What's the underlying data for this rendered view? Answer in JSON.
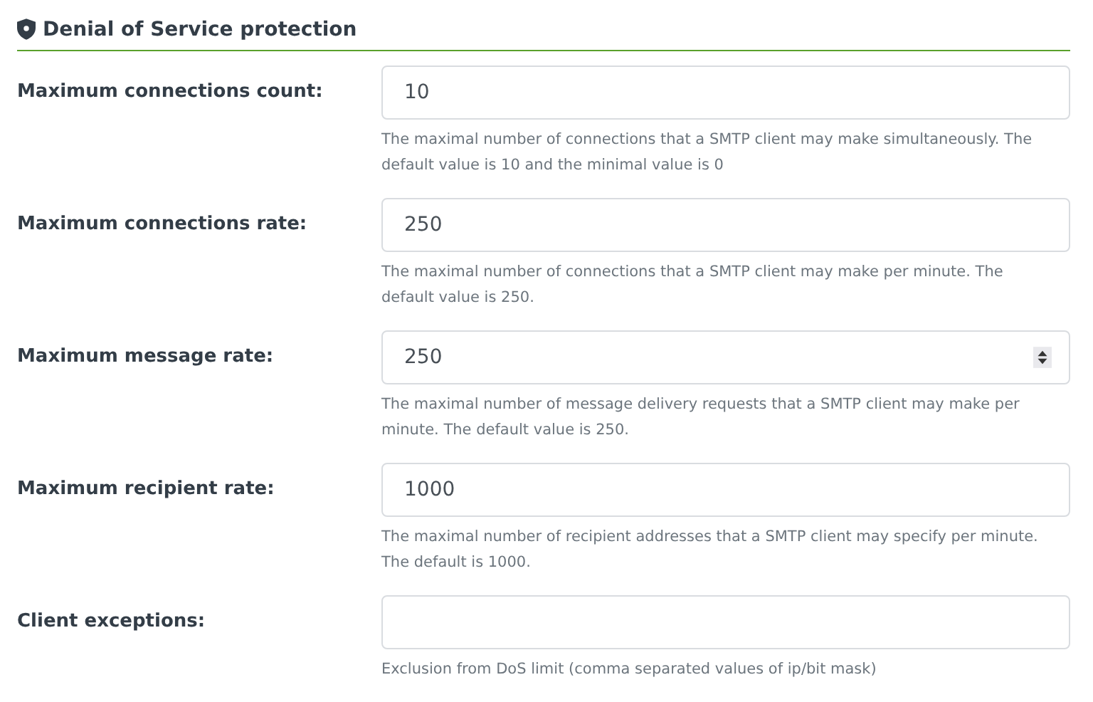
{
  "section": {
    "title": "Denial of Service protection"
  },
  "fields": [
    {
      "label": "Maximum connections count:",
      "value": "10",
      "kind": "text",
      "help": "The maximal number of connections that a SMTP client may make simultaneously. The default value is 10 and the minimal value is 0"
    },
    {
      "label": "Maximum connections rate:",
      "value": "250",
      "kind": "text",
      "help": "The maximal number of connections that a SMTP client may make per minute. The default value is 250."
    },
    {
      "label": "Maximum message rate:",
      "value": "250",
      "kind": "spinner",
      "help": "The maximal number of message delivery requests that a SMTP client may make per minute. The default value is 250."
    },
    {
      "label": "Maximum recipient rate:",
      "value": "1000",
      "kind": "text",
      "help": "The maximal number of recipient addresses that a SMTP client may specify per minute. The default is 1000."
    },
    {
      "label": "Client exceptions:",
      "kind": "text",
      "help": "Exclusion from DoS limit (comma separated values of ip/bit mask)"
    }
  ]
}
